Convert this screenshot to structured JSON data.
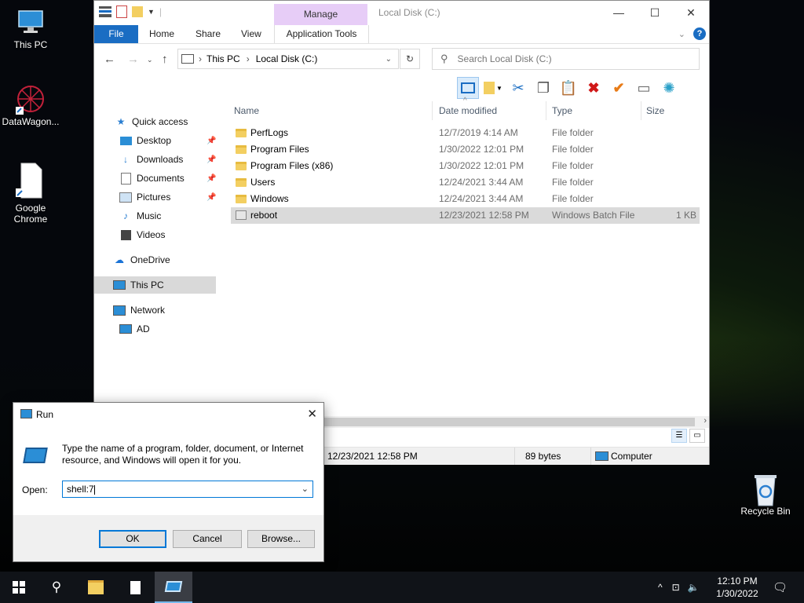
{
  "desktop": {
    "icons": [
      {
        "label": "This PC"
      },
      {
        "label": "DataWagon..."
      },
      {
        "label_line1": "Google",
        "label_line2": "Chrome"
      },
      {
        "label": "Recycle Bin"
      }
    ]
  },
  "explorer": {
    "title": "Local Disk (C:)",
    "manage_tab": "Manage",
    "ribbon_tabs": {
      "file": "File",
      "home": "Home",
      "share": "Share",
      "view": "View",
      "app_tools": "Application Tools"
    },
    "address": {
      "segments": [
        "This PC",
        "Local Disk (C:)"
      ]
    },
    "search_placeholder": "Search Local Disk (C:)",
    "nav": {
      "quick_access": "Quick access",
      "desktop": "Desktop",
      "downloads": "Downloads",
      "documents": "Documents",
      "pictures": "Pictures",
      "music": "Music",
      "videos": "Videos",
      "onedrive": "OneDrive",
      "this_pc": "This PC",
      "network": "Network",
      "ad": "AD"
    },
    "columns": {
      "name": "Name",
      "date": "Date modified",
      "type": "Type",
      "size": "Size"
    },
    "files": [
      {
        "name": "PerfLogs",
        "date": "12/7/2019 4:14 AM",
        "type": "File folder",
        "size": ""
      },
      {
        "name": "Program Files",
        "date": "1/30/2022 12:01 PM",
        "type": "File folder",
        "size": ""
      },
      {
        "name": "Program Files (x86)",
        "date": "1/30/2022 12:01 PM",
        "type": "File folder",
        "size": ""
      },
      {
        "name": "Users",
        "date": "12/24/2021 3:44 AM",
        "type": "File folder",
        "size": ""
      },
      {
        "name": "Windows",
        "date": "12/24/2021 3:44 AM",
        "type": "File folder",
        "size": ""
      },
      {
        "name": "reboot",
        "date": "12/23/2021 12:58 PM",
        "type": "Windows Batch File",
        "size": "1 KB"
      }
    ],
    "status": {
      "date": "12/23/2021 12:58 PM",
      "bytes": "89 bytes",
      "location": "Computer"
    }
  },
  "run": {
    "title": "Run",
    "description": "Type the name of a program, folder, document, or Internet resource, and Windows will open it for you.",
    "open_label": "Open:",
    "open_value": "shell:7",
    "ok": "OK",
    "cancel": "Cancel",
    "browse": "Browse..."
  },
  "taskbar": {
    "time": "12:10 PM",
    "date": "1/30/2022"
  }
}
